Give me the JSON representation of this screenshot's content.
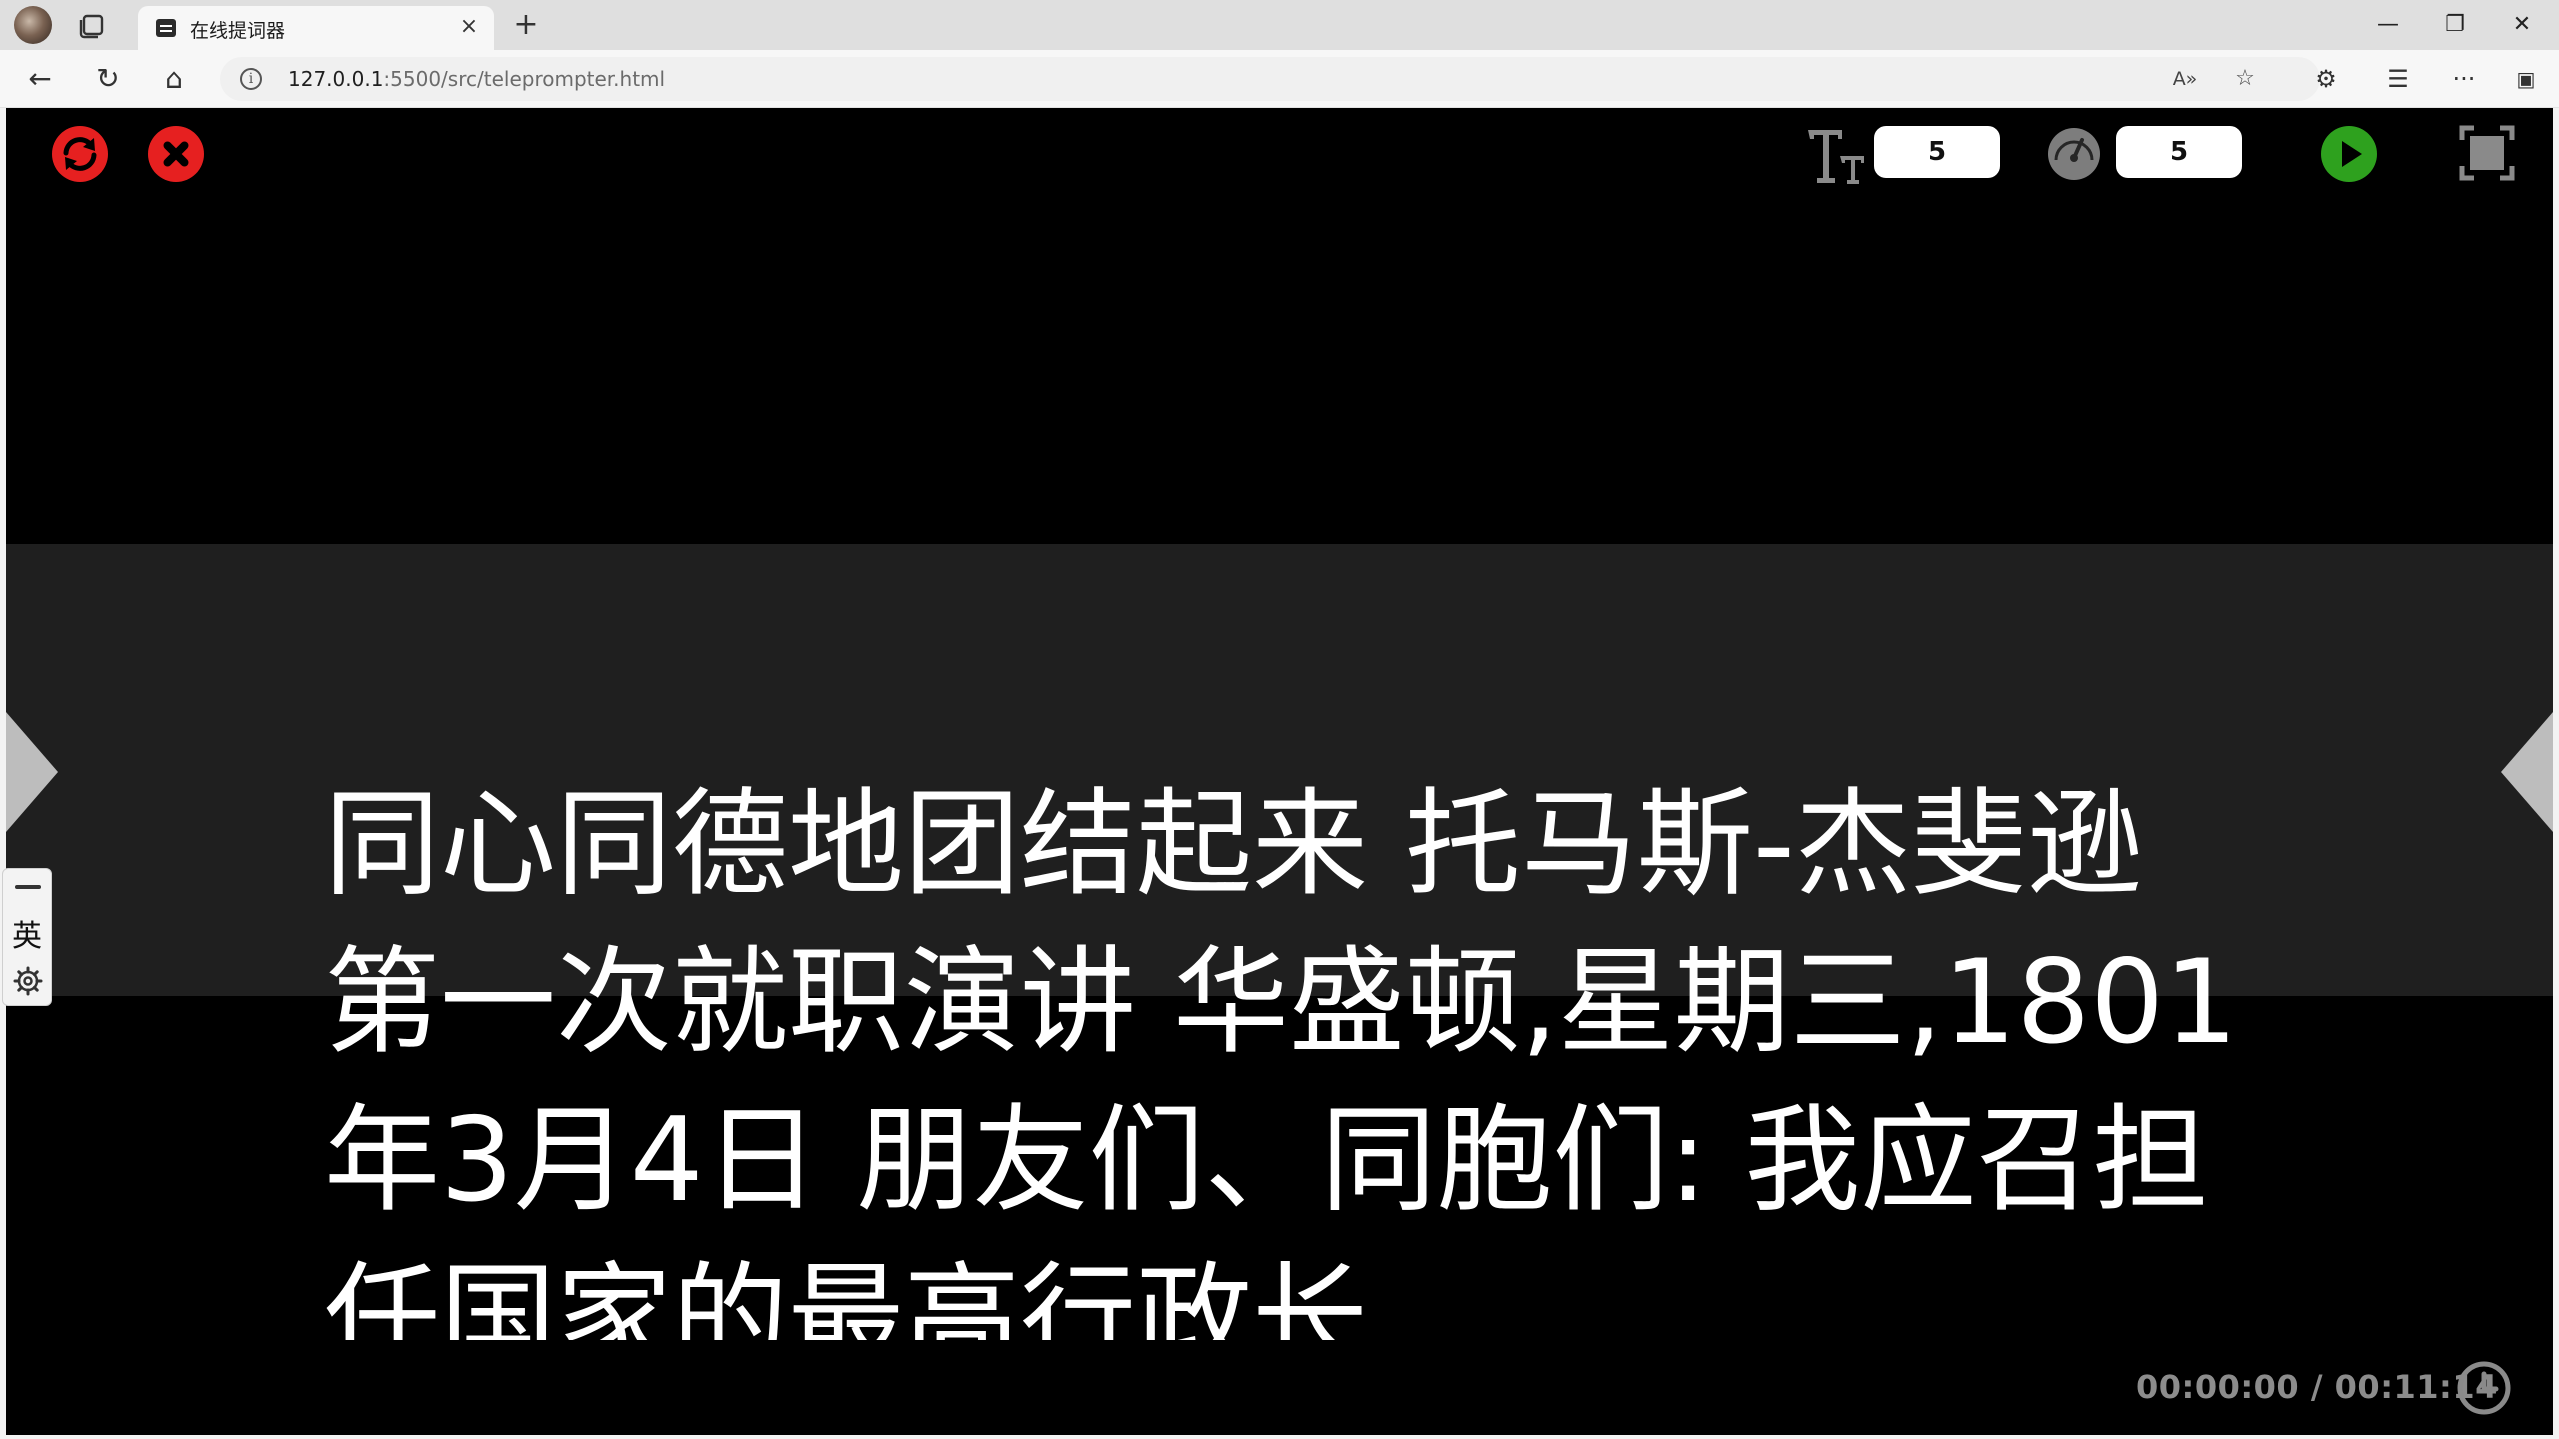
{
  "browser": {
    "tab_title": "在线提词器",
    "tab_close": "×",
    "new_tab": "+",
    "url_host": "127.0.0.1",
    "url_rest": ":5500/src/teleprompter.html",
    "window": {
      "minimize": "—",
      "restore": "❐",
      "close": "✕"
    },
    "nav": {
      "back": "←",
      "reload": "↻",
      "home": "⌂"
    },
    "toolbar_icons": {
      "read_aloud": "A»",
      "favorite": "☆",
      "extensions": "⚙",
      "favorites_list": "☰",
      "more": "···",
      "sidebar": "▣"
    }
  },
  "teleprompter": {
    "font_size_value": "5",
    "speed_value": "5",
    "script_text": "同心同德地团结起来 托马斯-杰斐逊 第一次就职演讲 华盛顿,星期三,1801年3月4日 朋友们、同胞们: 我应召担任国家的最高行政长",
    "timer": "00:00:00 / 00:11:14",
    "icons": [
      "refresh-icon",
      "close-icon",
      "font-size-icon",
      "speedometer-icon",
      "play-icon",
      "fullscreen-icon",
      "clock-icon"
    ],
    "colors": {
      "background": "#000000",
      "reading_band": "#1f1f1f",
      "danger": "#e62020",
      "play": "#2ea11e",
      "timer": "#8c8c8c"
    }
  },
  "ime": {
    "language": "英"
  }
}
